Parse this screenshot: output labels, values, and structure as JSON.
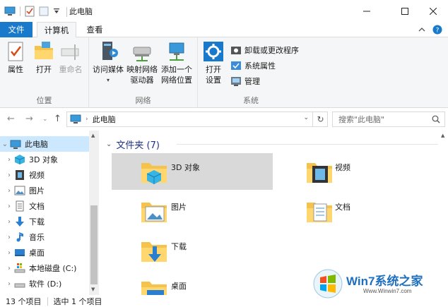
{
  "window": {
    "title": "此电脑"
  },
  "tabs": {
    "file": "文件",
    "computer": "计算机",
    "view": "查看"
  },
  "ribbon": {
    "location_group": {
      "label": "位置",
      "properties": "属性",
      "open": "打开",
      "rename": "重命名"
    },
    "network_group": {
      "label": "网络",
      "access_media_1": "访问媒体",
      "map_drive_1": "映射网络",
      "map_drive_2": "驱动器",
      "add_location_1": "添加一个",
      "add_location_2": "网络位置"
    },
    "system_group": {
      "label": "系统",
      "open_settings_1": "打开",
      "open_settings_2": "设置",
      "uninstall": "卸载或更改程序",
      "system_props": "系统属性",
      "manage": "管理"
    }
  },
  "address": {
    "path": "此电脑",
    "search_placeholder": "搜索\"此电脑\""
  },
  "nav": {
    "items": [
      {
        "label": "此电脑"
      },
      {
        "label": "3D 对象"
      },
      {
        "label": "视频"
      },
      {
        "label": "图片"
      },
      {
        "label": "文档"
      },
      {
        "label": "下载"
      },
      {
        "label": "音乐"
      },
      {
        "label": "桌面"
      },
      {
        "label": "本地磁盘 (C:)"
      },
      {
        "label": "软件 (D:)"
      }
    ]
  },
  "content": {
    "group_title": "文件夹 (7)",
    "folders": [
      {
        "label": "3D 对象"
      },
      {
        "label": "视频"
      },
      {
        "label": "图片"
      },
      {
        "label": "文档"
      },
      {
        "label": "下载"
      },
      {
        "label": "桌面"
      }
    ]
  },
  "status": {
    "count": "13 个项目",
    "selected": "选中 1 个项目"
  },
  "watermark": {
    "text": "Win7系统之家",
    "url": "Www.Winwin7.com"
  }
}
